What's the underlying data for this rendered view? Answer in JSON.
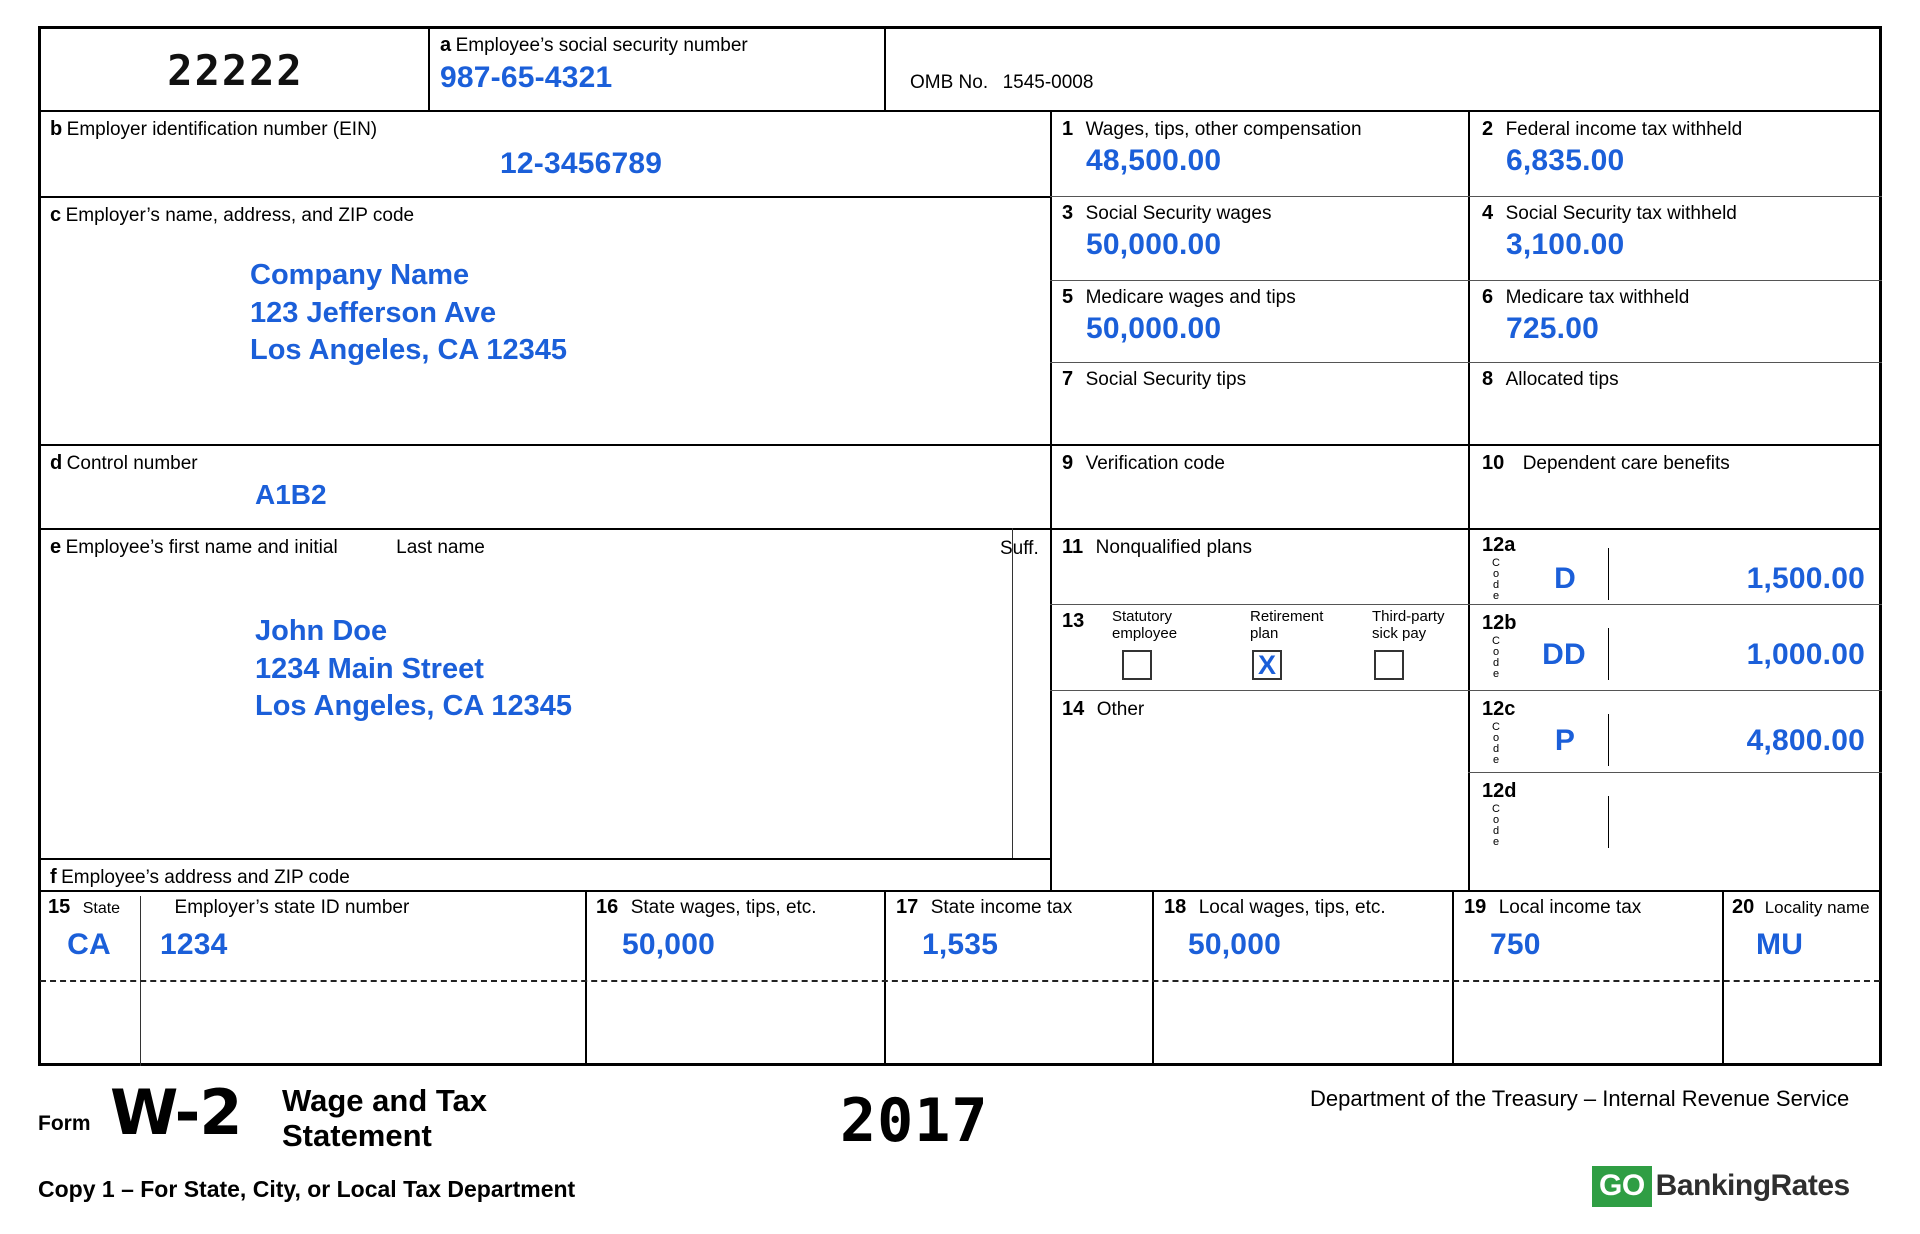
{
  "form": {
    "control_number_top": "22222",
    "omb_label": "OMB No.",
    "omb_number": "1545-0008"
  },
  "boxes": {
    "a": {
      "letter": "a",
      "label": "Employee’s social security number",
      "value": "987-65-4321"
    },
    "b": {
      "letter": "b",
      "label": "Employer identification number (EIN)",
      "value": "12-3456789"
    },
    "c": {
      "letter": "c",
      "label": "Employer’s name, address, and ZIP code",
      "line1": "Company Name",
      "line2": "123 Jefferson Ave",
      "line3": "Los Angeles, CA 12345"
    },
    "d": {
      "letter": "d",
      "label": "Control number",
      "value": "A1B2"
    },
    "e": {
      "letter": "e",
      "label": "Employee’s first name and initial",
      "label_last": "Last name",
      "label_suffix": "Suff.",
      "line1": "John Doe",
      "line2": "1234 Main Street",
      "line3": "Los Angeles, CA 12345"
    },
    "f": {
      "letter": "f",
      "label": "Employee’s address and ZIP code",
      "value": ""
    },
    "b1": {
      "num": "1",
      "label": "Wages, tips, other compensation",
      "value": "48,500.00"
    },
    "b2": {
      "num": "2",
      "label": "Federal income tax withheld",
      "value": "6,835.00"
    },
    "b3": {
      "num": "3",
      "label": "Social Security wages",
      "value": "50,000.00"
    },
    "b4": {
      "num": "4",
      "label": "Social Security tax withheld",
      "value": "3,100.00"
    },
    "b5": {
      "num": "5",
      "label": "Medicare wages and tips",
      "value": "50,000.00"
    },
    "b6": {
      "num": "6",
      "label": "Medicare tax withheld",
      "value": "725.00"
    },
    "b7": {
      "num": "7",
      "label": "Social Security tips",
      "value": ""
    },
    "b8": {
      "num": "8",
      "label": "Allocated tips",
      "value": ""
    },
    "b9": {
      "num": "9",
      "label": "Verification code",
      "value": ""
    },
    "b10": {
      "num": "10",
      "label": "Dependent care benefits",
      "value": ""
    },
    "b11": {
      "num": "11",
      "label": "Nonqualified plans",
      "value": ""
    },
    "b13": {
      "num": "13",
      "statutory_label_1": "Statutory",
      "statutory_label_2": "employee",
      "statutory_checked": "",
      "retirement_label_1": "Retirement",
      "retirement_label_2": "plan",
      "retirement_checked": "X",
      "thirdparty_label_1": "Third-party",
      "thirdparty_label_2": "sick pay",
      "thirdparty_checked": ""
    },
    "b14": {
      "num": "14",
      "label": "Other",
      "value": ""
    },
    "b12a": {
      "num": "12a",
      "code_word": "Code",
      "code": "D",
      "value": "1,500.00"
    },
    "b12b": {
      "num": "12b",
      "code_word": "Code",
      "code": "DD",
      "value": "1,000.00"
    },
    "b12c": {
      "num": "12c",
      "code_word": "Code",
      "code": "P",
      "value": "4,800.00"
    },
    "b12d": {
      "num": "12d",
      "code_word": "Code",
      "code": "",
      "value": ""
    },
    "b15": {
      "num": "15",
      "label": "State",
      "label2": "Employer’s state ID number",
      "state": "CA",
      "state_id": "1234",
      "state_row2": "",
      "state_id_row2": ""
    },
    "b16": {
      "num": "16",
      "label": "State wages, tips, etc.",
      "value": "50,000",
      "row2": ""
    },
    "b17": {
      "num": "17",
      "label": "State income tax",
      "value": "1,535",
      "row2": ""
    },
    "b18": {
      "num": "18",
      "label": "Local wages, tips, etc.",
      "value": "50,000",
      "row2": ""
    },
    "b19": {
      "num": "19",
      "label": "Local income tax",
      "value": "750",
      "row2": ""
    },
    "b20": {
      "num": "20",
      "label": "Locality name",
      "value": "MU",
      "row2": ""
    }
  },
  "footer": {
    "form_word": "Form",
    "form_id": "W-2",
    "title_line1": "Wage and Tax",
    "title_line2": "Statement",
    "copy_line": "Copy 1 – For State, City, or Local Tax Department",
    "year": "2017",
    "department": "Department of the Treasury – Internal Revenue Service"
  },
  "logo": {
    "go": "GO",
    "rest": "BankingRates"
  },
  "colors": {
    "value_blue": "#1b5fd9",
    "logo_green": "#2f9e44",
    "ink": "#000000"
  }
}
